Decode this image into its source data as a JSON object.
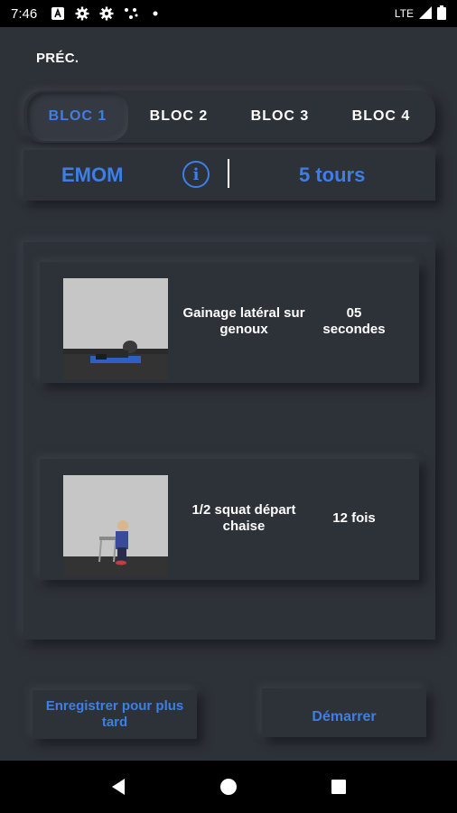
{
  "status_bar": {
    "time": "7:46",
    "network": "LTE",
    "icons": [
      "android-notification-icon",
      "gear-icon",
      "gear-icon",
      "nodes-icon",
      "dot-icon"
    ],
    "right_icons": [
      "signal-icon",
      "battery-icon"
    ]
  },
  "header": {
    "back_label": "PRÉC."
  },
  "tabs": [
    {
      "label": "BLOC 1",
      "active": true
    },
    {
      "label": "BLOC 2",
      "active": false
    },
    {
      "label": "BLOC 3",
      "active": false
    },
    {
      "label": "BLOC 4",
      "active": false
    }
  ],
  "workout": {
    "type": "EMOM",
    "rounds": "5 tours",
    "info_icon": "info-icon"
  },
  "exercises": [
    {
      "name": "Gainage latéral sur genoux",
      "quantity": "05 secondes",
      "thumbnail": "plank-thumbnail"
    },
    {
      "name": "1/2 squat départ chaise",
      "quantity": "12 fois",
      "thumbnail": "squat-thumbnail"
    }
  ],
  "buttons": {
    "save_label": "Enregistrer pour plus tard",
    "start_label": "Démarrer"
  },
  "navigation": {
    "icons": [
      "back-triangle-icon",
      "home-circle-icon",
      "recents-square-icon"
    ]
  },
  "colors": {
    "background": "#2d3138",
    "accent": "#3d7fe6",
    "text": "#ffffff"
  }
}
